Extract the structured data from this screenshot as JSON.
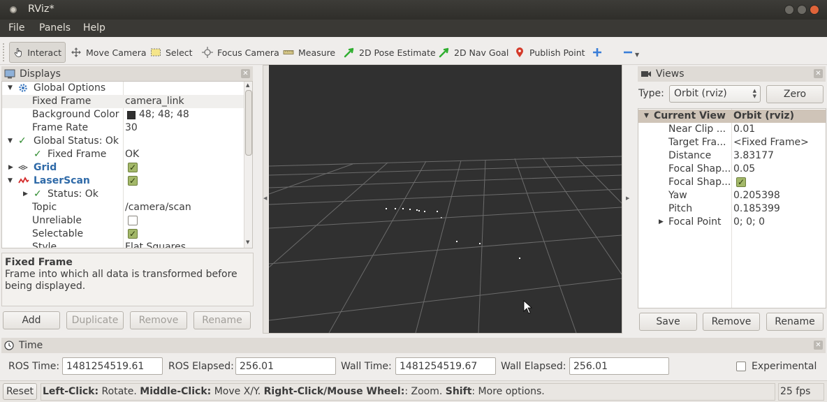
{
  "window": {
    "title": "RViz*"
  },
  "menu": [
    "File",
    "Panels",
    "Help"
  ],
  "toolbar": {
    "tools": [
      "Interact",
      "Move Camera",
      "Select",
      "Focus Camera",
      "Measure",
      "2D Pose Estimate",
      "2D Nav Goal",
      "Publish Point"
    ]
  },
  "displays": {
    "title": "Displays",
    "rows": [
      {
        "label": "Global Options",
        "value": ""
      },
      {
        "label": "Fixed Frame",
        "value": "camera_link"
      },
      {
        "label": "Background Color",
        "value": "48; 48; 48"
      },
      {
        "label": "Frame Rate",
        "value": "30"
      },
      {
        "label": "Global Status: Ok",
        "value": ""
      },
      {
        "label": "Fixed Frame",
        "value": "OK"
      },
      {
        "label": "Grid",
        "value": "checked"
      },
      {
        "label": "LaserScan",
        "value": "checked"
      },
      {
        "label": "Status: Ok",
        "value": ""
      },
      {
        "label": "Topic",
        "value": "/camera/scan"
      },
      {
        "label": "Unreliable",
        "value": "unchecked"
      },
      {
        "label": "Selectable",
        "value": "checked"
      },
      {
        "label": "Style",
        "value": "Flat Squares"
      }
    ],
    "desc_title": "Fixed Frame",
    "desc_text": "Frame into which all data is transformed before being displayed.",
    "buttons": {
      "add": "Add",
      "duplicate": "Duplicate",
      "remove": "Remove",
      "rename": "Rename"
    }
  },
  "views": {
    "title": "Views",
    "type_label": "Type:",
    "type_value": "Orbit (rviz)",
    "zero": "Zero",
    "header": {
      "label": "Current View",
      "value": "Orbit (rviz)"
    },
    "rows": [
      {
        "label": "Near Clip ...",
        "value": "0.01"
      },
      {
        "label": "Target Fra...",
        "value": "<Fixed Frame>"
      },
      {
        "label": "Distance",
        "value": "3.83177"
      },
      {
        "label": "Focal Shap...",
        "value": "0.05"
      },
      {
        "label": "Focal Shap...",
        "value": "checked"
      },
      {
        "label": "Yaw",
        "value": "0.205398"
      },
      {
        "label": "Pitch",
        "value": "0.185399"
      },
      {
        "label": "Focal Point",
        "value": "0; 0; 0"
      }
    ],
    "buttons": {
      "save": "Save",
      "remove": "Remove",
      "rename": "Rename"
    }
  },
  "time": {
    "title": "Time",
    "ros_time_label": "ROS Time:",
    "ros_time": "1481254519.61",
    "ros_elapsed_label": "ROS Elapsed:",
    "ros_elapsed": "256.01",
    "wall_time_label": "Wall Time:",
    "wall_time": "1481254519.67",
    "wall_elapsed_label": "Wall Elapsed:",
    "wall_elapsed": "256.01",
    "experimental": "Experimental"
  },
  "status": {
    "reset": "Reset",
    "k1": "Left-Click:",
    "t1": " Rotate. ",
    "k2": "Middle-Click:",
    "t2": " Move X/Y. ",
    "k3": "Right-Click/Mouse Wheel:",
    "t3": ": Zoom. ",
    "k4": "Shift",
    "t4": ": More options.",
    "fps": "25 fps"
  },
  "colors": {
    "viewport_bg": "#303030",
    "accent_green": "#2e8b2e",
    "category_blue": "#2f6aa8"
  }
}
